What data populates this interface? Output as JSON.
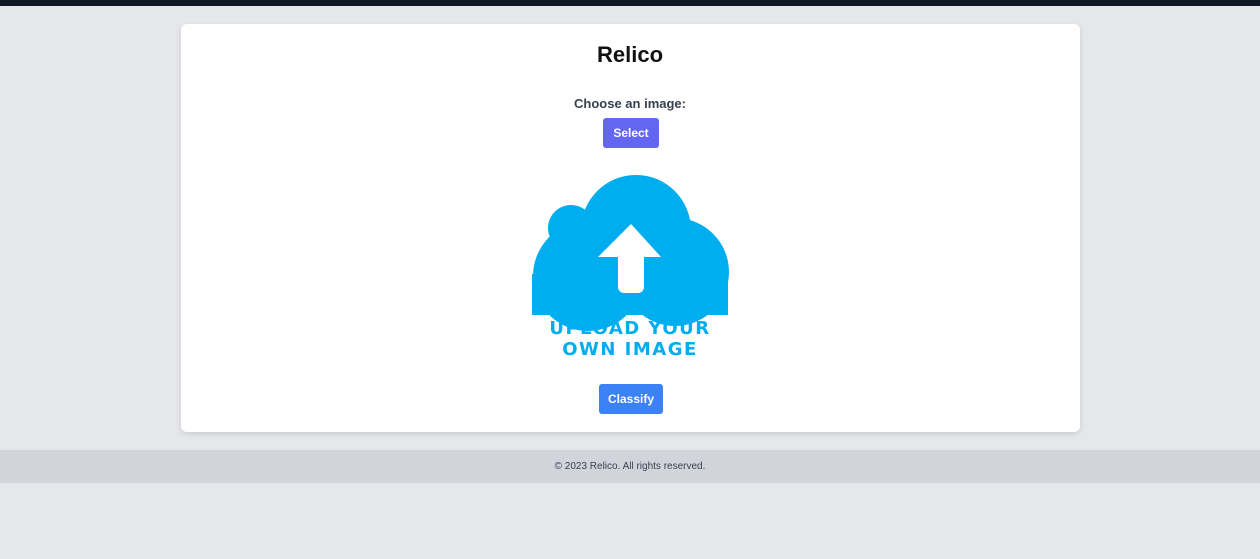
{
  "app": {
    "title": "Relico"
  },
  "upload": {
    "prompt": "Choose an image:",
    "select_label": "Select",
    "placeholder_line1": "UPLOAD YOUR",
    "placeholder_line2": "OWN IMAGE",
    "placeholder_icon": "cloud-upload-icon",
    "classify_label": "Classify"
  },
  "footer": {
    "text": "© 2023 Relico. All rights reserved."
  },
  "colors": {
    "page_background": "#e5e7eb",
    "top_bar": "#111827",
    "select_button": "#6366f1",
    "classify_button": "#3b82f6",
    "upload_icon": "#00adee",
    "footer_background": "#d1d5db"
  }
}
